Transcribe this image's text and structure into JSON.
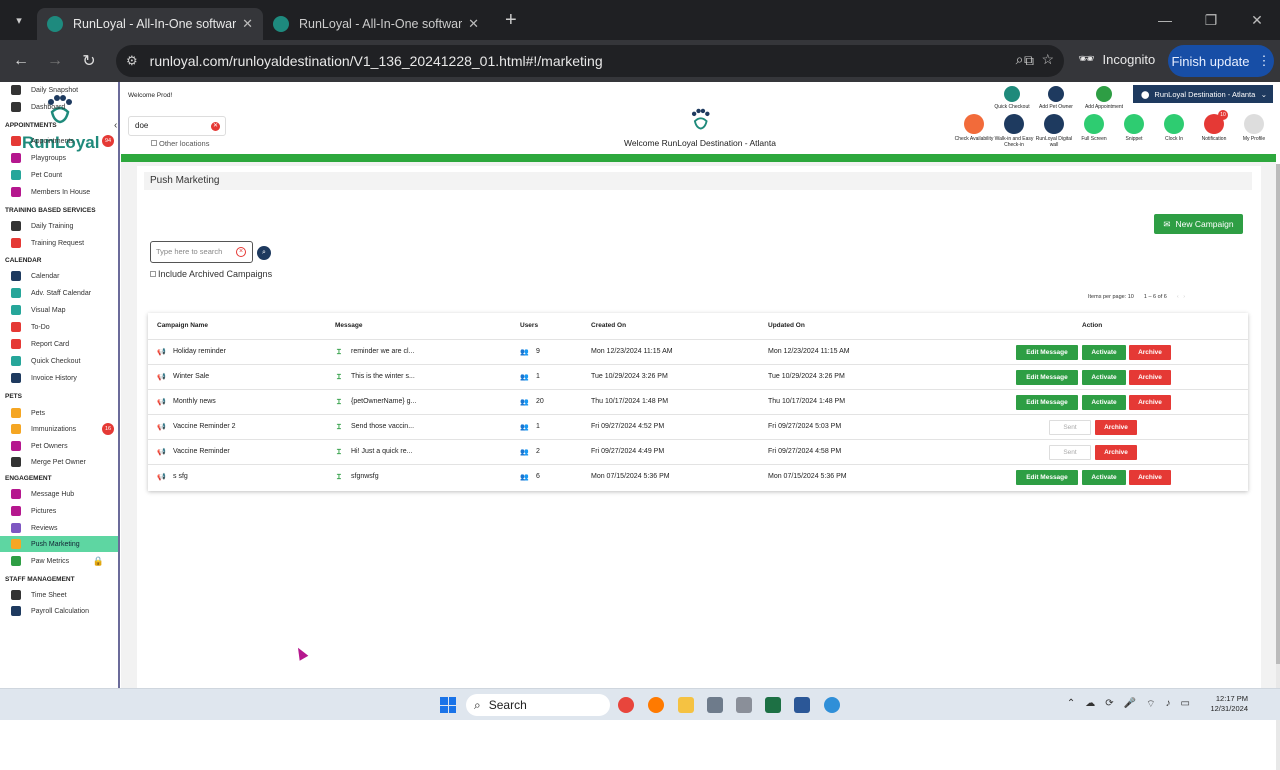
{
  "browser": {
    "tabs": [
      {
        "title": "RunLoyal - All-In-One software",
        "active": true
      },
      {
        "title": "RunLoyal - All-In-One software",
        "active": false
      }
    ],
    "url": "runloyal.com/runloyaldestination/V1_136_20241228_01.html#!/marketing",
    "incognito_label": "Incognito",
    "finish_update_label": "Finish update"
  },
  "app": {
    "logo_text": "RunLoyal",
    "welcome_prod": "Welcome Prod!",
    "location_search_value": "doe",
    "other_locations_label": "Other locations",
    "center_title": "Welcome RunLoyal Destination - Atlanta",
    "location_dropdown": "RunLoyal Destination - Atlanta",
    "top_actions_row1": [
      {
        "label": "Quick Checkout",
        "color": "#1f8a7b"
      },
      {
        "label": "Add Pet Owner",
        "color": "#1e3a5f"
      },
      {
        "label": "Add Appointment",
        "color": "#2e9e44"
      }
    ],
    "top_actions_row2": [
      {
        "label": "Check Availability",
        "color": "#f26b3a"
      },
      {
        "label": "Walk-in and Easy Check-in",
        "color": "#1e3a5f"
      },
      {
        "label": "RunLoyal Digital wall",
        "color": "#1e3a5f"
      },
      {
        "label": "Full Screen",
        "color": "#2ecc71"
      },
      {
        "label": "Snippet",
        "color": "#2ecc71"
      },
      {
        "label": "Clock In",
        "color": "#2ecc71"
      },
      {
        "label": "Notification",
        "color": "#e53935",
        "badge": "10"
      },
      {
        "label": "My Profile",
        "color": "#ddd"
      }
    ]
  },
  "sidebar": {
    "items": [
      {
        "type": "item",
        "label": "Daily Snapshot",
        "color": "#333"
      },
      {
        "type": "item",
        "label": "Dashboard",
        "color": "#333"
      },
      {
        "type": "head",
        "label": "APPOINTMENTS"
      },
      {
        "type": "item",
        "label": "Appointments",
        "color": "#e53935",
        "badge": "94"
      },
      {
        "type": "item",
        "label": "Playgroups",
        "color": "#b5178e"
      },
      {
        "type": "item",
        "label": "Pet Count",
        "color": "#26a69a"
      },
      {
        "type": "item",
        "label": "Members In House",
        "color": "#b5178e"
      },
      {
        "type": "head",
        "label": "TRAINING BASED SERVICES"
      },
      {
        "type": "item",
        "label": "Daily Training",
        "color": "#333"
      },
      {
        "type": "item",
        "label": "Training Request",
        "color": "#e53935"
      },
      {
        "type": "head",
        "label": "CALENDAR"
      },
      {
        "type": "item",
        "label": "Calendar",
        "color": "#1e3a5f"
      },
      {
        "type": "item",
        "label": "Adv. Staff Calendar",
        "color": "#26a69a"
      },
      {
        "type": "item",
        "label": "Visual Map",
        "color": "#26a69a"
      },
      {
        "type": "item",
        "label": "To-Do",
        "color": "#e53935"
      },
      {
        "type": "item",
        "label": "Report Card",
        "color": "#e53935"
      },
      {
        "type": "item",
        "label": "Quick Checkout",
        "color": "#26a69a"
      },
      {
        "type": "item",
        "label": "Invoice History",
        "color": "#1e3a5f"
      },
      {
        "type": "head",
        "label": "PETS"
      },
      {
        "type": "item",
        "label": "Pets",
        "color": "#f5a623"
      },
      {
        "type": "item",
        "label": "Immunizations",
        "color": "#f5a623",
        "badge": "16"
      },
      {
        "type": "item",
        "label": "Pet Owners",
        "color": "#b5178e"
      },
      {
        "type": "item",
        "label": "Merge Pet Owner",
        "color": "#333"
      },
      {
        "type": "head",
        "label": "ENGAGEMENT"
      },
      {
        "type": "item",
        "label": "Message Hub",
        "color": "#b5178e"
      },
      {
        "type": "item",
        "label": "Pictures",
        "color": "#b5178e"
      },
      {
        "type": "item",
        "label": "Reviews",
        "color": "#7e57c2"
      },
      {
        "type": "item",
        "label": "Push Marketing",
        "color": "#f5a623",
        "active": true
      },
      {
        "type": "item",
        "label": "Paw Metrics",
        "color": "#2e9e44",
        "locked": true
      },
      {
        "type": "head",
        "label": "STAFF MANAGEMENT"
      },
      {
        "type": "item",
        "label": "Time Sheet",
        "color": "#333"
      },
      {
        "type": "item",
        "label": "Payroll Calculation",
        "color": "#1e3a5f"
      }
    ]
  },
  "marketing": {
    "title": "Push Marketing",
    "new_campaign_label": "New Campaign",
    "search_placeholder": "Type here to search",
    "include_archived_label": "Include Archived Campaigns",
    "items_per_page_label": "Items per page:",
    "items_per_page": "10",
    "range_label": "1 – 6 of 6",
    "columns": [
      "Campaign Name",
      "Message",
      "Users",
      "Created On",
      "Updated On",
      "Action"
    ],
    "rows": [
      {
        "name": "Holiday reminder",
        "message": "reminder we are cl...",
        "users": "9",
        "created": "Mon 12/23/2024 11:15 AM",
        "updated": "Mon 12/23/2024 11:15 AM",
        "sent": false
      },
      {
        "name": "Winter Sale",
        "message": "This is the winter s...",
        "users": "1",
        "created": "Tue 10/29/2024 3:26 PM",
        "updated": "Tue 10/29/2024 3:26 PM",
        "sent": false
      },
      {
        "name": "Monthly news",
        "message": "{petOwnerName} g...",
        "users": "20",
        "created": "Thu 10/17/2024 1:48 PM",
        "updated": "Thu 10/17/2024 1:48 PM",
        "sent": false
      },
      {
        "name": "Vaccine Reminder 2",
        "message": "Send those vaccin...",
        "users": "1",
        "created": "Fri 09/27/2024 4:52 PM",
        "updated": "Fri 09/27/2024 5:03 PM",
        "sent": true
      },
      {
        "name": "Vaccine Reminder",
        "message": "Hi! Just a quick re...",
        "users": "2",
        "created": "Fri 09/27/2024 4:49 PM",
        "updated": "Fri 09/27/2024 4:58 PM",
        "sent": true
      },
      {
        "name": "s sfg",
        "message": "sfgnwsfg",
        "users": "6",
        "created": "Mon 07/15/2024 5:36 PM",
        "updated": "Mon 07/15/2024 5:36 PM",
        "sent": false
      }
    ],
    "btn_edit": "Edit Message",
    "btn_activate": "Activate",
    "btn_archive": "Archive",
    "btn_sent": "Sent"
  },
  "taskbar": {
    "search_label": "Search",
    "time": "12:17 PM",
    "date": "12/31/2024"
  }
}
